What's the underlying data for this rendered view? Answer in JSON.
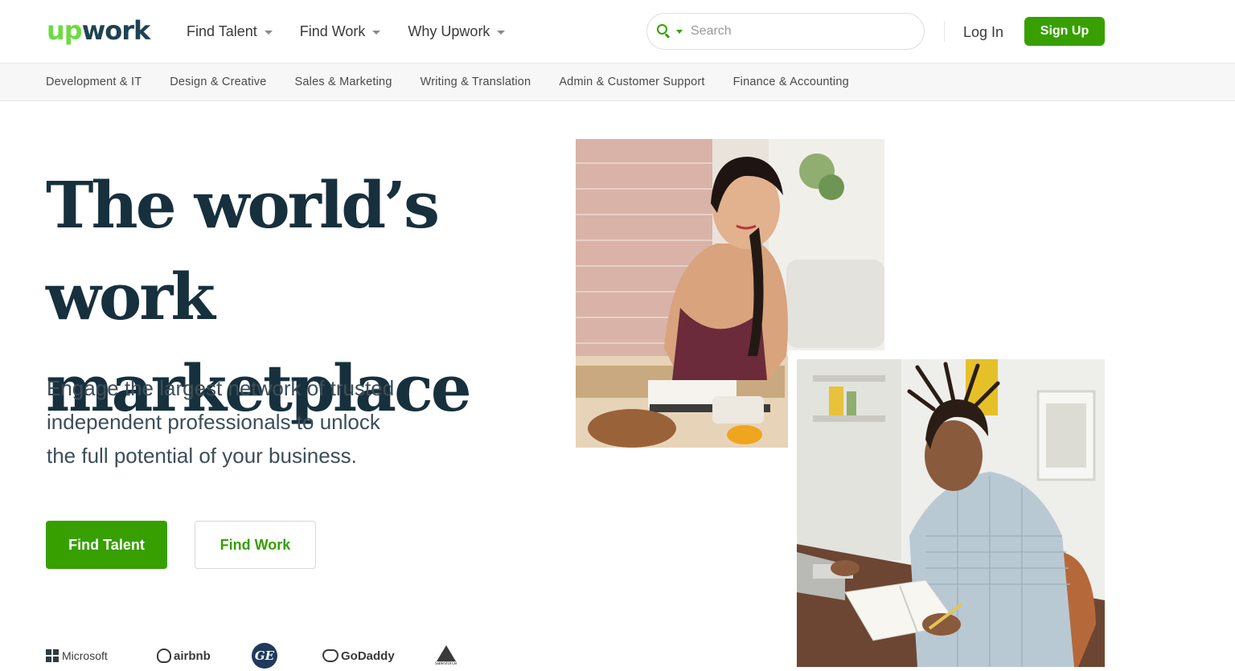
{
  "header": {
    "logo": {
      "up": "up",
      "work": "work"
    },
    "nav": [
      {
        "label": "Find Talent"
      },
      {
        "label": "Find Work"
      },
      {
        "label": "Why Upwork"
      }
    ],
    "search": {
      "placeholder": "Search"
    },
    "login_label": "Log In",
    "signup_label": "Sign Up"
  },
  "categories": [
    "Development & IT",
    "Design & Creative",
    "Sales & Marketing",
    "Writing & Translation",
    "Admin & Customer Support",
    "Finance & Accounting"
  ],
  "hero": {
    "title_line1": "The world’s work",
    "title_line2": "marketplace",
    "subtitle_line1": "Engage the largest network of trusted",
    "subtitle_line2": "independent professionals to unlock",
    "subtitle_line3": "the full potential of your business.",
    "primary_cta": "Find Talent",
    "secondary_cta": "Find Work"
  },
  "client_logos": {
    "microsoft": "Microsoft",
    "airbnb": "airbnb",
    "ge": "GE",
    "godaddy": "GoDaddy",
    "salesforce": "salesforce"
  },
  "colors": {
    "brand_green": "#37a000",
    "logo_green": "#6fda44",
    "heading_navy": "#17303e",
    "logo_navy": "#1d4354"
  }
}
